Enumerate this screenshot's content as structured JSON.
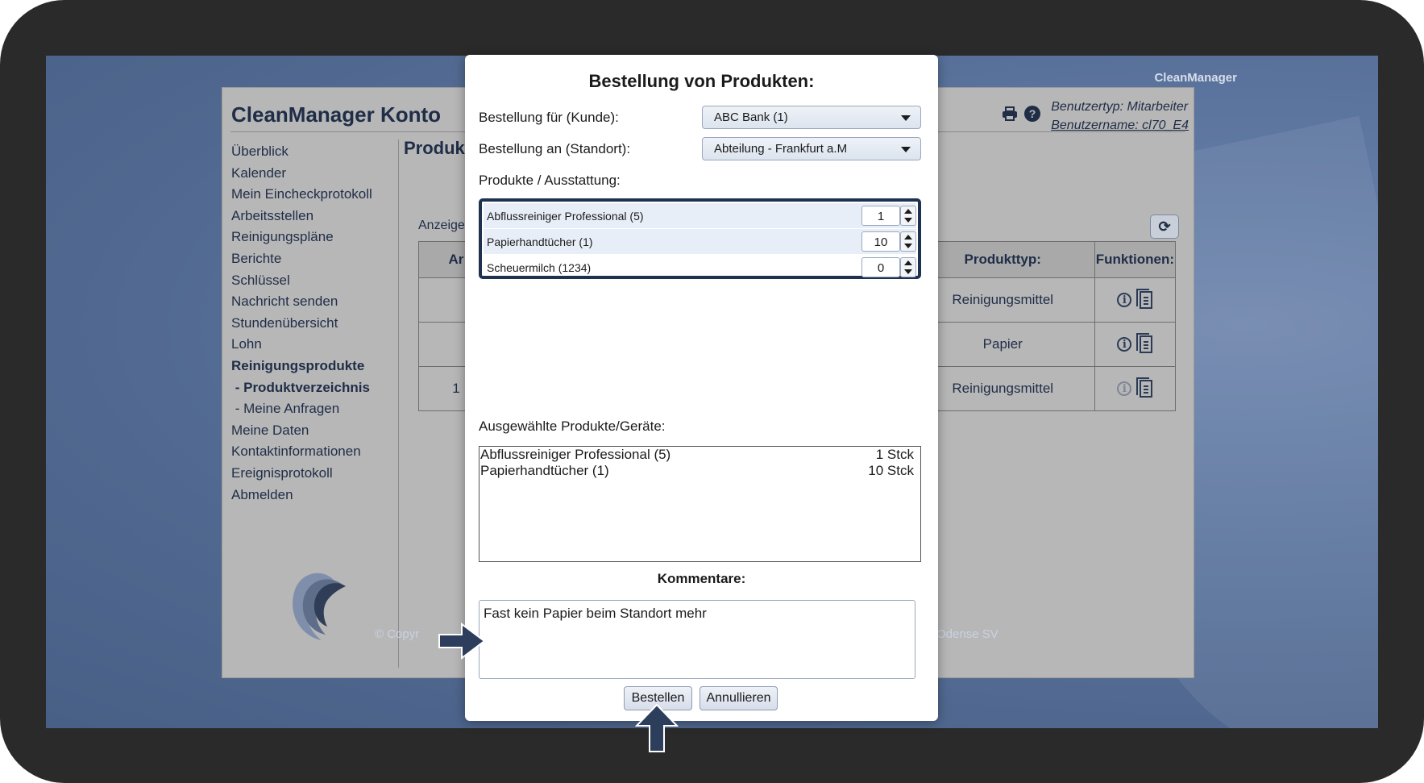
{
  "brand_corner": "CleanManager",
  "account": {
    "title": "CleanManager Konto",
    "user_type": "Benutzertyp: Mitarbeiter",
    "user_name": "Benutzername: cl70_E4"
  },
  "nav": [
    {
      "label": "Überblick"
    },
    {
      "label": "Kalender"
    },
    {
      "label": "Mein Eincheckprotokoll"
    },
    {
      "label": "Arbeitsstellen"
    },
    {
      "label": "Reinigungspläne"
    },
    {
      "label": "Berichte"
    },
    {
      "label": "Schlüssel"
    },
    {
      "label": "Nachricht senden"
    },
    {
      "label": "Stundenübersicht"
    },
    {
      "label": "Lohn"
    },
    {
      "label": "Reinigungsprodukte"
    },
    {
      "label": " - Produktverzeichnis"
    },
    {
      "label": " - Meine Anfragen"
    },
    {
      "label": "Meine Daten"
    },
    {
      "label": "Kontaktinformationen"
    },
    {
      "label": "Ereignisprotokoll"
    },
    {
      "label": "Abmelden"
    }
  ],
  "background_page": {
    "section_title": "Produkt",
    "show_label": "Anzeige",
    "table": {
      "headers": [
        "Ar",
        "Produkttyp:",
        "Funktionen:"
      ],
      "rows": [
        {
          "first": "",
          "type": "Reinigungsmittel"
        },
        {
          "first": "",
          "type": "Papier"
        },
        {
          "first": "1",
          "type": "Reinigungsmittel"
        }
      ]
    },
    "footer_left": "© Copyr",
    "footer_right": "Odense SV"
  },
  "modal": {
    "title": "Bestellung von Produkten:",
    "customer_label": "Bestellung für (Kunde):",
    "customer_value": "ABC Bank (1)",
    "location_label": "Bestellung an (Standort):",
    "location_value": "Abteilung - Frankfurt a.M",
    "products_label": "Produkte / Ausstattung:",
    "products": [
      {
        "name": "Abflussreiniger Professional (5)",
        "qty": "1"
      },
      {
        "name": "Papierhandtücher (1)",
        "qty": "10"
      },
      {
        "name": "Scheuermilch (1234)",
        "qty": "0"
      }
    ],
    "selected_label": "Ausgewählte Produkte/Geräte:",
    "selected": [
      {
        "name": "Abflussreiniger Professional (5)",
        "amount": "1 Stck"
      },
      {
        "name": "Papierhandtücher (1)",
        "amount": "10 Stck"
      }
    ],
    "comment_title": "Kommentare:",
    "comment_value": "Fast kein Papier beim Standort mehr",
    "order_button": "Bestellen",
    "cancel_button": "Annullieren"
  },
  "colors": {
    "accent_navy": "#1f3150",
    "screen_bg": "#5d76a0",
    "card_bg": "#b7b7b7"
  },
  "icons": [
    "print-icon",
    "help-icon",
    "refresh-icon",
    "info-icon",
    "document-icon",
    "dropdown-caret-icon",
    "spinner-icon",
    "arrow-right-icon",
    "arrow-up-icon",
    "logo"
  ]
}
